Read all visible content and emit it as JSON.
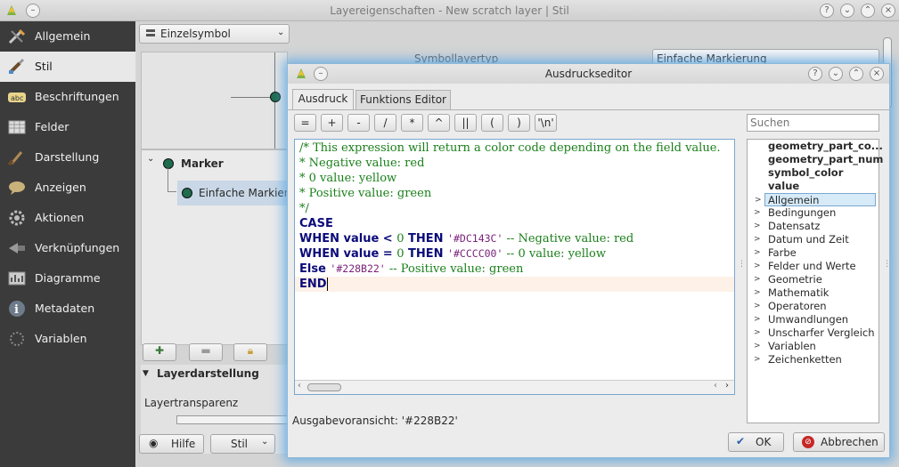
{
  "main_window": {
    "title": "Layereigenschaften - New scratch layer | Stil",
    "sidebar": [
      {
        "label": "Allgemein",
        "icon": "tools-icon"
      },
      {
        "label": "Stil",
        "icon": "paintbrush-icon"
      },
      {
        "label": "Beschriftungen",
        "icon": "abc-label-icon"
      },
      {
        "label": "Felder",
        "icon": "table-icon"
      },
      {
        "label": "Darstellung",
        "icon": "brush-icon"
      },
      {
        "label": "Anzeigen",
        "icon": "speech-bubble-icon"
      },
      {
        "label": "Aktionen",
        "icon": "gear-icon"
      },
      {
        "label": "Verknüpfungen",
        "icon": "join-icon"
      },
      {
        "label": "Diagramme",
        "icon": "diagram-icon"
      },
      {
        "label": "Metadaten",
        "icon": "info-icon"
      },
      {
        "label": "Variablen",
        "icon": "variables-icon"
      }
    ],
    "renderer_combo": "Einzelsymbol",
    "symbol_layer_type_label": "Symbollayertyp",
    "symbol_layer_type_value": "Einfache Markierung",
    "tree": {
      "root": "Marker",
      "child": "Einfache Markierung"
    },
    "layer_rendering_header": "Layerdarstellung",
    "layer_transparency_label": "Layertransparenz",
    "help_button": "Hilfe",
    "style_button": "Stil"
  },
  "dialog": {
    "title": "Ausdruckseditor",
    "tabs": [
      "Ausdruck",
      "Funktions Editor"
    ],
    "operators": [
      "=",
      "+",
      "-",
      "/",
      "*",
      "^",
      "||",
      "(",
      ")",
      "'\\n'"
    ],
    "code_lines": [
      [
        {
          "t": "/* This expression will return a color code depending on the field value.",
          "c": "cm"
        }
      ],
      [
        {
          "t": "* Negative value: red",
          "c": "cm"
        }
      ],
      [
        {
          "t": "* 0 value: yellow",
          "c": "cm"
        }
      ],
      [
        {
          "t": "* Positive value: green",
          "c": "cm"
        }
      ],
      [
        {
          "t": "*/",
          "c": "cm"
        }
      ],
      [
        {
          "t": "CASE",
          "c": "kw"
        }
      ],
      [
        {
          "t": "WHEN value < ",
          "c": "kw"
        },
        {
          "t": "0",
          "c": "num"
        },
        {
          "t": " THEN ",
          "c": "kw"
        },
        {
          "t": "'#DC143C'",
          "c": "str"
        },
        {
          "t": " -- Negative value: red",
          "c": "cm"
        }
      ],
      [
        {
          "t": "WHEN value = ",
          "c": "kw"
        },
        {
          "t": "0",
          "c": "num"
        },
        {
          "t": " THEN ",
          "c": "kw"
        },
        {
          "t": "'#CCCC00'",
          "c": "str"
        },
        {
          "t": " -- 0 value: yellow",
          "c": "cm"
        }
      ],
      [
        {
          "t": "Else ",
          "c": "kw"
        },
        {
          "t": "'#228B22'",
          "c": "str"
        },
        {
          "t": " -- Positive value: green",
          "c": "cm"
        }
      ],
      [
        {
          "t": "END",
          "c": "kw"
        }
      ]
    ],
    "preview_label": "Ausgabevoransicht:",
    "preview_value": "'#228B22'",
    "search_placeholder": "Suchen",
    "function_fields": [
      "geometry_part_co...",
      "geometry_part_num",
      "symbol_color",
      "value"
    ],
    "function_groups": [
      "Allgemein",
      "Bedingungen",
      "Datensatz",
      "Datum und Zeit",
      "Farbe",
      "Felder und Werte",
      "Geometrie",
      "Mathematik",
      "Operatoren",
      "Umwandlungen",
      "Unscharfer Vergleich",
      "Variablen",
      "Zeichenketten"
    ],
    "ok_button": "OK",
    "cancel_button": "Abbrechen"
  },
  "colors": {
    "sidebar_bg": "#3b3b3b",
    "selection": "#d6eaf8",
    "glow": "#5faae6"
  }
}
